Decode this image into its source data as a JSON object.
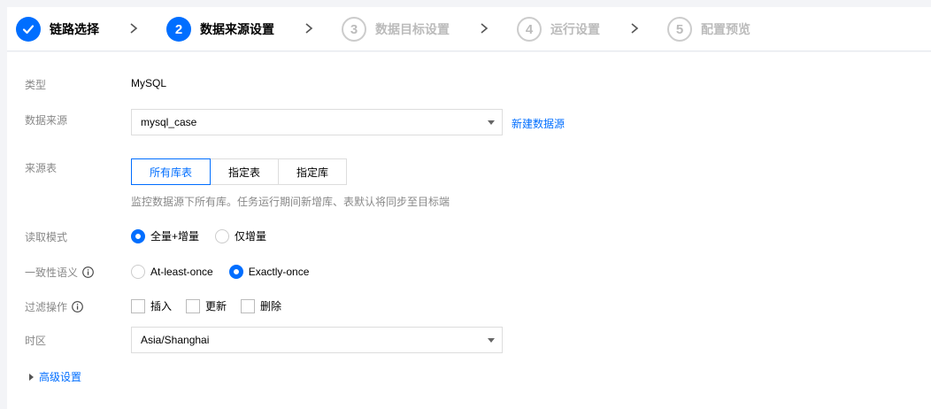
{
  "steps": [
    {
      "num": "",
      "label": "链路选择",
      "state": "done"
    },
    {
      "num": "2",
      "label": "数据来源设置",
      "state": "active"
    },
    {
      "num": "3",
      "label": "数据目标设置",
      "state": "todo"
    },
    {
      "num": "4",
      "label": "运行设置",
      "state": "todo"
    },
    {
      "num": "5",
      "label": "配置预览",
      "state": "todo"
    }
  ],
  "form": {
    "type": {
      "label": "类型",
      "value": "MySQL"
    },
    "source": {
      "label": "数据来源",
      "value": "mysql_case",
      "link": "新建数据源"
    },
    "table": {
      "label": "来源表",
      "options": [
        "所有库表",
        "指定表",
        "指定库"
      ],
      "selected": "所有库表",
      "hint": "监控数据源下所有库。任务运行期间新增库、表默认将同步至目标端"
    },
    "read_mode": {
      "label": "读取模式",
      "options": [
        "全量+增量",
        "仅增量"
      ],
      "selected": "全量+增量"
    },
    "consistency": {
      "label": "一致性语义",
      "options": [
        "At-least-once",
        "Exactly-once"
      ],
      "selected": "Exactly-once"
    },
    "filter": {
      "label": "过滤操作",
      "options": [
        "插入",
        "更新",
        "删除"
      ]
    },
    "timezone": {
      "label": "时区",
      "value": "Asia/Shanghai"
    },
    "advanced": "高级设置"
  },
  "colors": {
    "accent": "#006eff",
    "muted": "#888888",
    "border": "#dddddd"
  }
}
